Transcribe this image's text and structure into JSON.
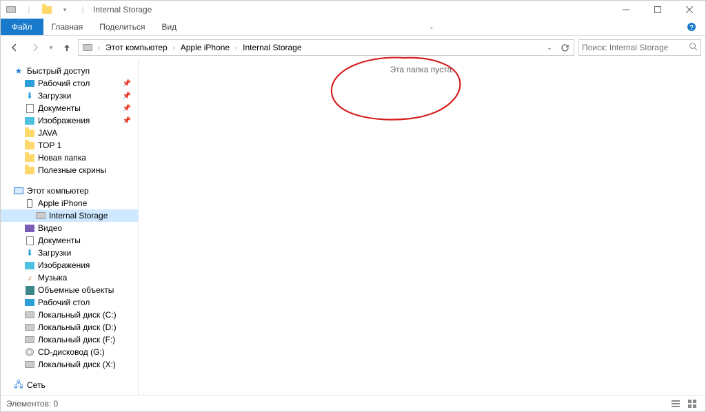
{
  "window": {
    "title": "Internal Storage"
  },
  "ribbon": {
    "file": "Файл",
    "home": "Главная",
    "share": "Поделиться",
    "view": "Вид"
  },
  "breadcrumb": {
    "root": "Этот компьютер",
    "device": "Apple iPhone",
    "storage": "Internal Storage"
  },
  "search": {
    "placeholder": "Поиск: Internal Storage"
  },
  "sidebar": {
    "quick_access": "Быстрый доступ",
    "quick": [
      {
        "label": "Рабочий стол",
        "icon": "desktop"
      },
      {
        "label": "Загрузки",
        "icon": "downloads"
      },
      {
        "label": "Документы",
        "icon": "documents"
      },
      {
        "label": "Изображения",
        "icon": "pictures"
      },
      {
        "label": "JAVA",
        "icon": "folder"
      },
      {
        "label": "TOP 1",
        "icon": "folder"
      },
      {
        "label": "Новая папка",
        "icon": "folder"
      },
      {
        "label": "Полезные скрины",
        "icon": "folder"
      }
    ],
    "this_pc": "Этот компьютер",
    "pc": [
      {
        "label": "Apple iPhone",
        "icon": "phone"
      },
      {
        "label": "Internal Storage",
        "icon": "drive",
        "selected": true,
        "indent": 2
      },
      {
        "label": "Видео",
        "icon": "video"
      },
      {
        "label": "Документы",
        "icon": "documents"
      },
      {
        "label": "Загрузки",
        "icon": "downloads"
      },
      {
        "label": "Изображения",
        "icon": "pictures"
      },
      {
        "label": "Музыка",
        "icon": "music"
      },
      {
        "label": "Объемные объекты",
        "icon": "3d"
      },
      {
        "label": "Рабочий стол",
        "icon": "desktop"
      },
      {
        "label": "Локальный диск (C:)",
        "icon": "drive"
      },
      {
        "label": "Локальный диск (D:)",
        "icon": "drive"
      },
      {
        "label": "Локальный диск (F:)",
        "icon": "drive"
      },
      {
        "label": "CD-дисковод (G:)",
        "icon": "disc"
      },
      {
        "label": "Локальный диск (X:)",
        "icon": "drive"
      }
    ],
    "network": "Сеть"
  },
  "content": {
    "empty": "Эта папка пуста."
  },
  "status": {
    "count": "Элементов: 0"
  }
}
